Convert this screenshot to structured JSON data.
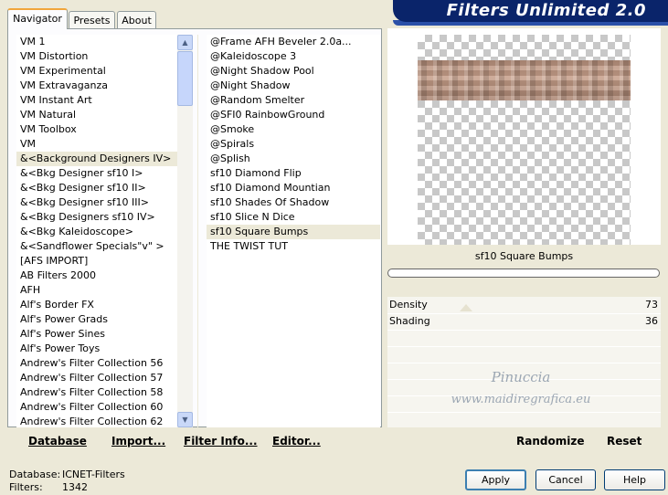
{
  "tabs": [
    {
      "label": "Navigator"
    },
    {
      "label": "Presets"
    },
    {
      "label": "About"
    }
  ],
  "banner": {
    "title": "Filters Unlimited 2.0"
  },
  "categories": [
    "VM 1",
    "VM Distortion",
    "VM Experimental",
    "VM Extravaganza",
    "VM Instant Art",
    "VM Natural",
    "VM Toolbox",
    "VM",
    "&<Background Designers IV>",
    "&<Bkg Designer sf10 I>",
    "&<Bkg Designer sf10 II>",
    "&<Bkg Designer sf10 III>",
    "&<Bkg Designers sf10 IV>",
    "&<Bkg Kaleidoscope>",
    "&<Sandflower Specials\"v\" >",
    "[AFS IMPORT]",
    "AB Filters 2000",
    "AFH",
    "Alf's Border FX",
    "Alf's Power Grads",
    "Alf's Power Sines",
    "Alf's Power Toys",
    "Andrew's Filter Collection 56",
    "Andrew's Filter Collection 57",
    "Andrew's Filter Collection 58",
    "Andrew's Filter Collection 60",
    "Andrew's Filter Collection 62"
  ],
  "filters": [
    "@Frame AFH Beveler 2.0a...",
    "@Kaleidoscope 3",
    "@Night Shadow Pool",
    "@Night Shadow",
    "@Random Smelter",
    "@SFI0 RainbowGround",
    "@Smoke",
    "@Spirals",
    "@Splish",
    "sf10 Diamond Flip",
    "sf10 Diamond Mountian",
    "sf10 Shades Of Shadow",
    "sf10 Slice N Dice",
    "sf10 Square Bumps",
    "THE TWIST TUT"
  ],
  "preview": {
    "filter_name": "sf10 Square Bumps"
  },
  "sliders": [
    {
      "label": "Density",
      "value": "73"
    },
    {
      "label": "Shading",
      "value": "36"
    }
  ],
  "watermark": {
    "line1": "Pinuccia",
    "line2": "www.maidiregrafica.eu"
  },
  "toolbar": {
    "database": "Database",
    "import": "Import...",
    "filter_info": "Filter Info...",
    "editor": "Editor...",
    "randomize": "Randomize",
    "reset": "Reset"
  },
  "status": {
    "database_label": "Database:",
    "database_value": "ICNET-Filters",
    "filters_label": "Filters:",
    "filters_value": "1342"
  },
  "buttons": {
    "apply": "Apply",
    "cancel": "Cancel",
    "help": "Help"
  }
}
